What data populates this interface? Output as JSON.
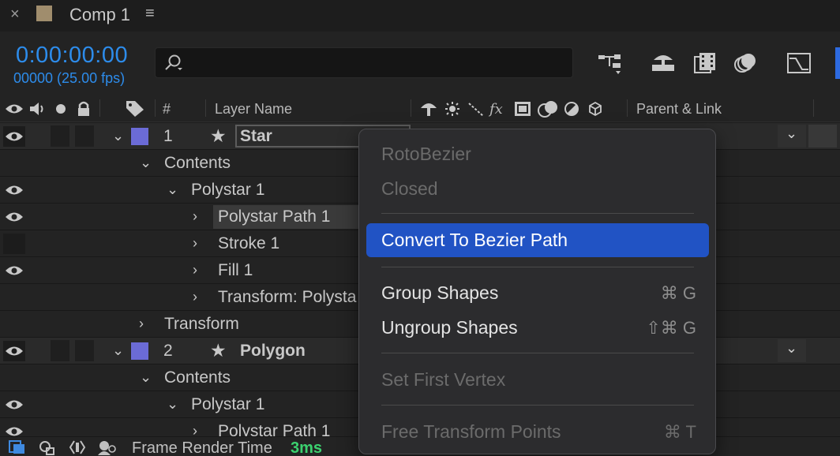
{
  "tab": {
    "close": "×",
    "title": "Comp 1",
    "menu": "≡"
  },
  "header": {
    "timecode": "0:00:00:00",
    "frames": "00000 (25.00 fps)",
    "search_value": ""
  },
  "columns": {
    "number": "#",
    "layer_name": "Layer Name",
    "fx": "fx",
    "parent": "Parent & Link"
  },
  "rows": [
    {
      "type": "layer",
      "number": "1",
      "name": "Star"
    },
    {
      "type": "prop",
      "label": "Contents"
    },
    {
      "type": "prop",
      "label": "Polystar 1"
    },
    {
      "type": "prop",
      "label": "Polystar Path 1"
    },
    {
      "type": "prop",
      "label": "Stroke 1"
    },
    {
      "type": "prop",
      "label": "Fill 1"
    },
    {
      "type": "prop",
      "label": "Transform: Polysta"
    },
    {
      "type": "prop",
      "label": "Transform"
    },
    {
      "type": "layer",
      "number": "2",
      "name": "Polygon"
    },
    {
      "type": "prop",
      "label": "Contents"
    },
    {
      "type": "prop",
      "label": "Polystar 1"
    },
    {
      "type": "prop",
      "label": "Polystar Path 1"
    }
  ],
  "status": {
    "label": "Frame Render Time",
    "value": "3ms"
  },
  "context_menu": {
    "items": [
      {
        "label": "RotoBezier",
        "enabled": false,
        "shortcut": ""
      },
      {
        "label": "Closed",
        "enabled": false,
        "shortcut": ""
      },
      {
        "label": "Convert To Bezier Path",
        "enabled": true,
        "highlighted": true,
        "shortcut": ""
      },
      {
        "label": "Group Shapes",
        "enabled": true,
        "shortcut": "⌘ G"
      },
      {
        "label": "Ungroup Shapes",
        "enabled": true,
        "shortcut": "⇧⌘ G"
      },
      {
        "label": "Set First Vertex",
        "enabled": false,
        "shortcut": ""
      },
      {
        "label": "Free Transform Points",
        "enabled": false,
        "shortcut": "⌘ T"
      }
    ]
  },
  "colors": {
    "timecode": "#2d8ceb",
    "highlight": "#2153c4",
    "render_time": "#3bd16f",
    "label_color": "#6b6bd6"
  }
}
